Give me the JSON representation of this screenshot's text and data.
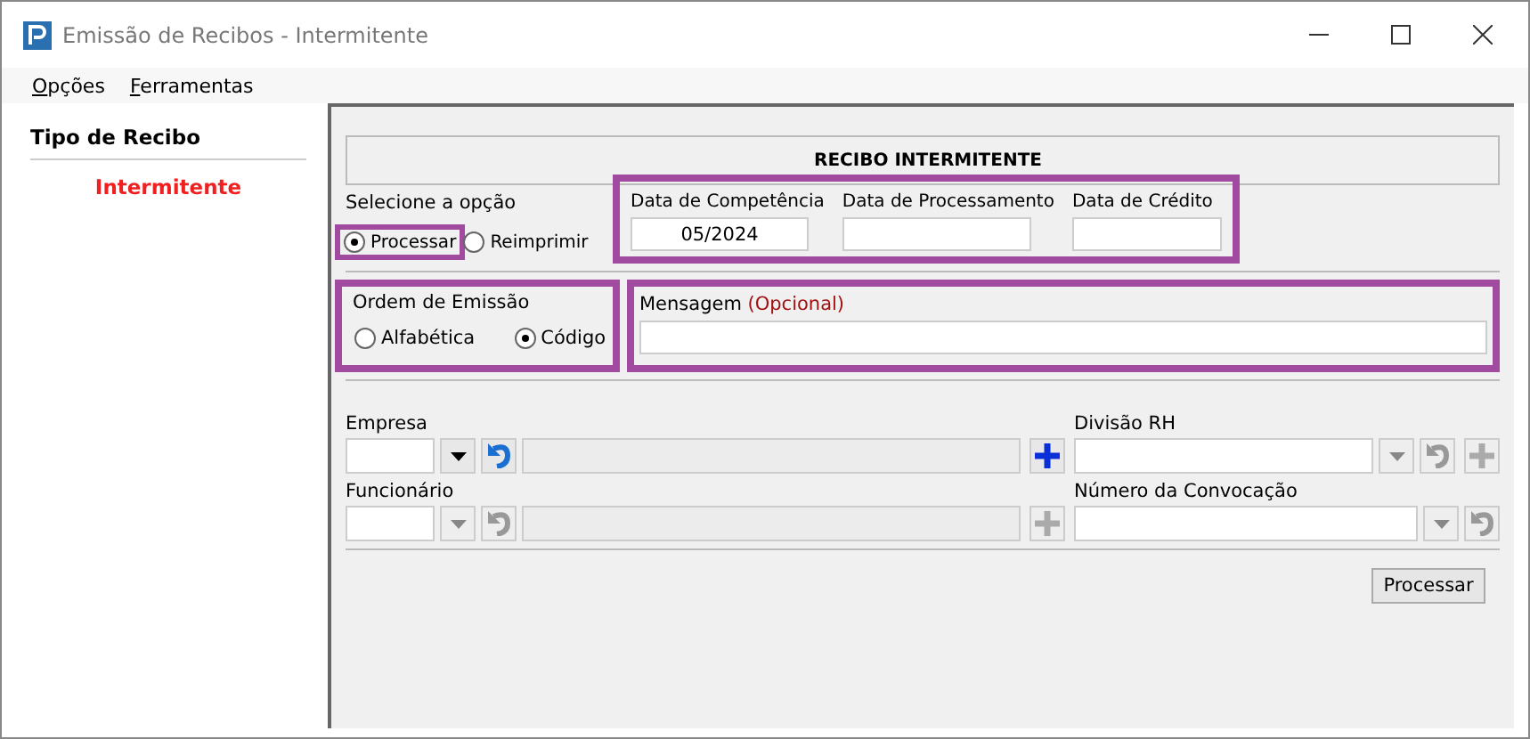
{
  "window": {
    "title": "Emissão de Recibos - Intermitente"
  },
  "menu": [
    {
      "label": "Opções"
    },
    {
      "label": "Ferramentas"
    }
  ],
  "sidebar": {
    "title": "Tipo de Recibo",
    "items": [
      {
        "label": "Intermitente",
        "selected": true
      }
    ]
  },
  "header": "RECIBO INTERMITENTE",
  "option_group": {
    "label": "Selecione a opção",
    "options": [
      {
        "label": "Processar",
        "selected": true,
        "highlighted": true
      },
      {
        "label": "Reimprimir",
        "selected": false,
        "highlighted": false
      }
    ]
  },
  "dates": {
    "highlighted": true,
    "fields": [
      {
        "label": "Data de Competência",
        "value": "05/2024"
      },
      {
        "label": "Data de Processamento"
      },
      {
        "label": "Data de Crédito"
      }
    ]
  },
  "order": {
    "label": "Ordem de Emissão",
    "highlighted": true,
    "options": [
      {
        "label": "Alfabética",
        "selected": false
      },
      {
        "label": "Código",
        "selected": true
      }
    ]
  },
  "message": {
    "label": "Mensagem",
    "note": "(Opcional)",
    "highlighted": true
  },
  "lookups": [
    {
      "label": "Empresa",
      "parts": [
        {
          "kind": "code"
        },
        {
          "kind": "dropdown",
          "disabled": false
        },
        {
          "kind": "undo",
          "disabled": false
        },
        {
          "kind": "desc"
        },
        {
          "kind": "add",
          "disabled": false
        }
      ]
    },
    {
      "label": "Divisão RH",
      "parts": [
        {
          "kind": "field"
        },
        {
          "kind": "dropdown",
          "disabled": true
        },
        {
          "kind": "undo",
          "disabled": true
        },
        {
          "kind": "add",
          "disabled": true
        }
      ]
    },
    {
      "label": "Funcionário",
      "parts": [
        {
          "kind": "code"
        },
        {
          "kind": "dropdown",
          "disabled": true
        },
        {
          "kind": "undo",
          "disabled": true
        },
        {
          "kind": "desc"
        },
        {
          "kind": "add",
          "disabled": true
        }
      ]
    },
    {
      "label": "Número da Convocação",
      "parts": [
        {
          "kind": "field"
        },
        {
          "kind": "dropdown",
          "disabled": true
        },
        {
          "kind": "undo",
          "disabled": true
        }
      ]
    }
  ],
  "action_button": "Processar"
}
